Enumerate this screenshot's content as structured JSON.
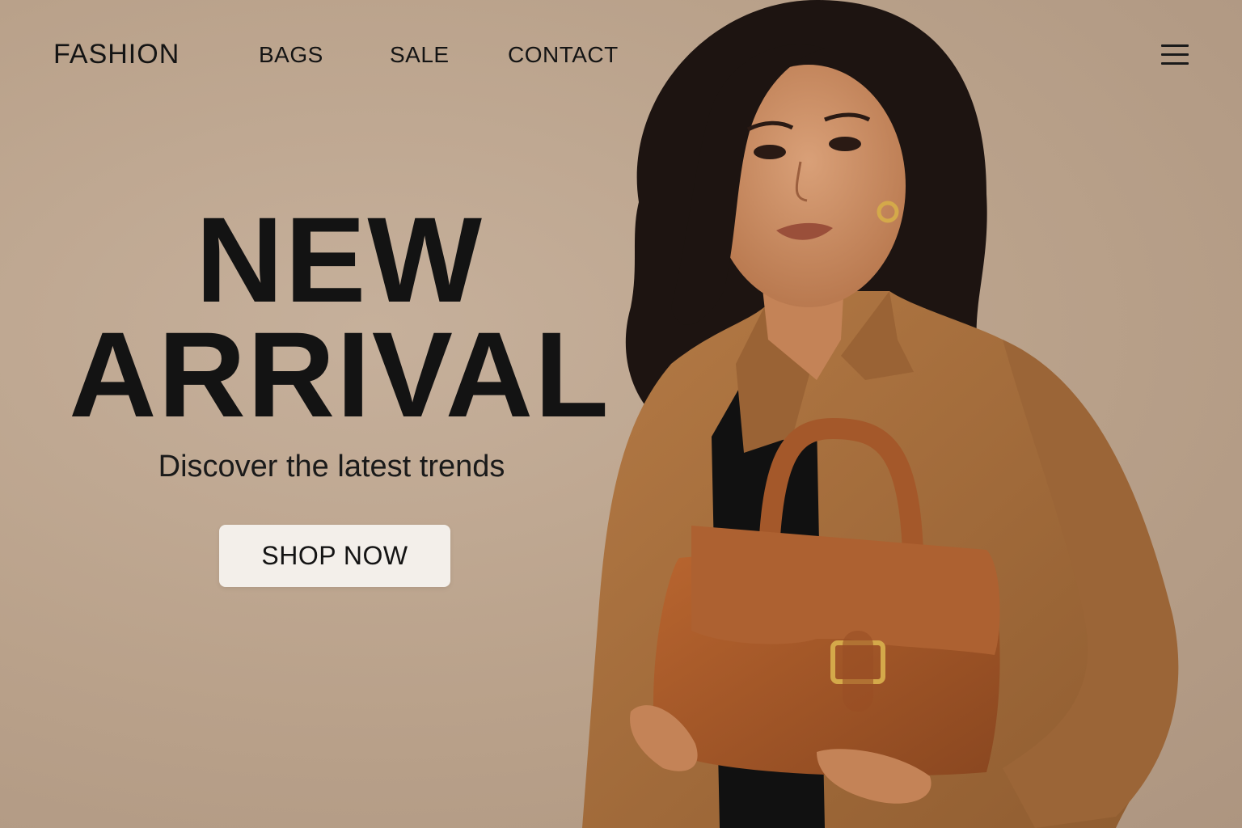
{
  "nav": {
    "brand": "FASHION",
    "links": [
      "BAGS",
      "SALE",
      "CONTACT"
    ],
    "menu_icon": "hamburger-menu-icon"
  },
  "hero": {
    "title_line1": "NEW",
    "title_line2": "ARRIVAL",
    "subtitle": "Discover the latest trends",
    "cta_label": "SHOP NOW"
  },
  "colors": {
    "background": "#bea791",
    "text": "#141414",
    "button_bg": "#f3efea",
    "blazer": "#a8713f",
    "bag": "#a4582a",
    "hardware": "#d4a94a"
  },
  "image": {
    "subject": "model-holding-brown-handbag"
  }
}
